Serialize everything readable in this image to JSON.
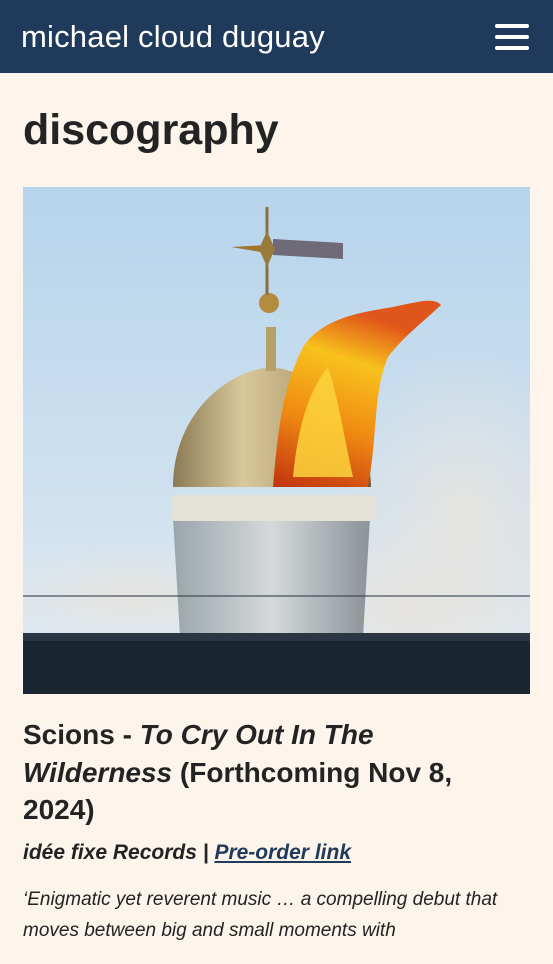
{
  "header": {
    "site_title": "michael cloud duguay",
    "menu_icon": "hamburger-menu-icon",
    "background_color": "#1f3a5a"
  },
  "page": {
    "title": "discography",
    "background_color": "#fdf4eb"
  },
  "release": {
    "artist": "Scions",
    "separator": " - ",
    "album": "To Cry Out In The Wilderness",
    "release_note": " (Forthcoming Nov 8, 2024)",
    "label": "idée fixe Records",
    "label_separator": " | ",
    "preorder_link": "Pre-order link",
    "quote": "‘Enigmatic yet reverent music … a compelling debut that moves between big and small moments with",
    "cover_image": "album-cover-burning-dome"
  }
}
